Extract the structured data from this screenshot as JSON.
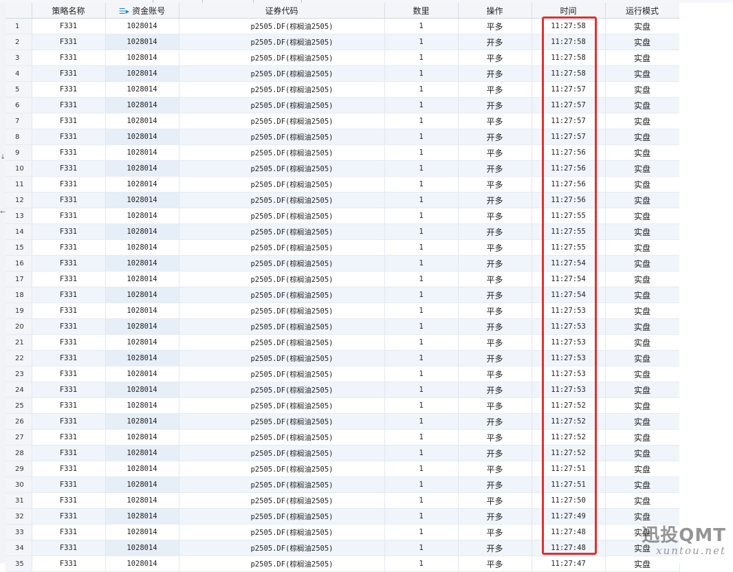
{
  "table": {
    "columns": [
      "",
      "策略名称",
      "资金账号",
      "证券代码",
      "数里",
      "操作",
      "时间",
      "运行模式"
    ],
    "sorted_column_icon": "sort-desc-icon",
    "rows": [
      {
        "n": "1",
        "strategy": "F331",
        "account": "1028014",
        "code": "p2505.DF(棕榈油2505)",
        "qty": "1",
        "op": "平多",
        "time": "11:27:58",
        "mode": "实盘"
      },
      {
        "n": "2",
        "strategy": "F331",
        "account": "1028014",
        "code": "p2505.DF(棕榈油2505)",
        "qty": "1",
        "op": "开多",
        "time": "11:27:58",
        "mode": "实盘"
      },
      {
        "n": "3",
        "strategy": "F331",
        "account": "1028014",
        "code": "p2505.DF(棕榈油2505)",
        "qty": "1",
        "op": "平多",
        "time": "11:27:58",
        "mode": "实盘"
      },
      {
        "n": "4",
        "strategy": "F331",
        "account": "1028014",
        "code": "p2505.DF(棕榈油2505)",
        "qty": "1",
        "op": "开多",
        "time": "11:27:58",
        "mode": "实盘"
      },
      {
        "n": "5",
        "strategy": "F331",
        "account": "1028014",
        "code": "p2505.DF(棕榈油2505)",
        "qty": "1",
        "op": "平多",
        "time": "11:27:57",
        "mode": "实盘"
      },
      {
        "n": "6",
        "strategy": "F331",
        "account": "1028014",
        "code": "p2505.DF(棕榈油2505)",
        "qty": "1",
        "op": "开多",
        "time": "11:27:57",
        "mode": "实盘"
      },
      {
        "n": "7",
        "strategy": "F331",
        "account": "1028014",
        "code": "p2505.DF(棕榈油2505)",
        "qty": "1",
        "op": "平多",
        "time": "11:27:57",
        "mode": "实盘"
      },
      {
        "n": "8",
        "strategy": "F331",
        "account": "1028014",
        "code": "p2505.DF(棕榈油2505)",
        "qty": "1",
        "op": "开多",
        "time": "11:27:57",
        "mode": "实盘"
      },
      {
        "n": "9",
        "strategy": "F331",
        "account": "1028014",
        "code": "p2505.DF(棕榈油2505)",
        "qty": "1",
        "op": "平多",
        "time": "11:27:56",
        "mode": "实盘"
      },
      {
        "n": "10",
        "strategy": "F331",
        "account": "1028014",
        "code": "p2505.DF(棕榈油2505)",
        "qty": "1",
        "op": "开多",
        "time": "11:27:56",
        "mode": "实盘"
      },
      {
        "n": "11",
        "strategy": "F331",
        "account": "1028014",
        "code": "p2505.DF(棕榈油2505)",
        "qty": "1",
        "op": "平多",
        "time": "11:27:56",
        "mode": "实盘"
      },
      {
        "n": "12",
        "strategy": "F331",
        "account": "1028014",
        "code": "p2505.DF(棕榈油2505)",
        "qty": "1",
        "op": "开多",
        "time": "11:27:56",
        "mode": "实盘"
      },
      {
        "n": "13",
        "strategy": "F331",
        "account": "1028014",
        "code": "p2505.DF(棕榈油2505)",
        "qty": "1",
        "op": "平多",
        "time": "11:27:55",
        "mode": "实盘"
      },
      {
        "n": "14",
        "strategy": "F331",
        "account": "1028014",
        "code": "p2505.DF(棕榈油2505)",
        "qty": "1",
        "op": "开多",
        "time": "11:27:55",
        "mode": "实盘"
      },
      {
        "n": "15",
        "strategy": "F331",
        "account": "1028014",
        "code": "p2505.DF(棕榈油2505)",
        "qty": "1",
        "op": "平多",
        "time": "11:27:55",
        "mode": "实盘"
      },
      {
        "n": "16",
        "strategy": "F331",
        "account": "1028014",
        "code": "p2505.DF(棕榈油2505)",
        "qty": "1",
        "op": "开多",
        "time": "11:27:54",
        "mode": "实盘"
      },
      {
        "n": "17",
        "strategy": "F331",
        "account": "1028014",
        "code": "p2505.DF(棕榈油2505)",
        "qty": "1",
        "op": "平多",
        "time": "11:27:54",
        "mode": "实盘"
      },
      {
        "n": "18",
        "strategy": "F331",
        "account": "1028014",
        "code": "p2505.DF(棕榈油2505)",
        "qty": "1",
        "op": "开多",
        "time": "11:27:54",
        "mode": "实盘"
      },
      {
        "n": "19",
        "strategy": "F331",
        "account": "1028014",
        "code": "p2505.DF(棕榈油2505)",
        "qty": "1",
        "op": "平多",
        "time": "11:27:53",
        "mode": "实盘"
      },
      {
        "n": "20",
        "strategy": "F331",
        "account": "1028014",
        "code": "p2505.DF(棕榈油2505)",
        "qty": "1",
        "op": "开多",
        "time": "11:27:53",
        "mode": "实盘"
      },
      {
        "n": "21",
        "strategy": "F331",
        "account": "1028014",
        "code": "p2505.DF(棕榈油2505)",
        "qty": "1",
        "op": "平多",
        "time": "11:27:53",
        "mode": "实盘"
      },
      {
        "n": "22",
        "strategy": "F331",
        "account": "1028014",
        "code": "p2505.DF(棕榈油2505)",
        "qty": "1",
        "op": "开多",
        "time": "11:27:53",
        "mode": "实盘"
      },
      {
        "n": "23",
        "strategy": "F331",
        "account": "1028014",
        "code": "p2505.DF(棕榈油2505)",
        "qty": "1",
        "op": "平多",
        "time": "11:27:53",
        "mode": "实盘"
      },
      {
        "n": "24",
        "strategy": "F331",
        "account": "1028014",
        "code": "p2505.DF(棕榈油2505)",
        "qty": "1",
        "op": "开多",
        "time": "11:27:53",
        "mode": "实盘"
      },
      {
        "n": "25",
        "strategy": "F331",
        "account": "1028014",
        "code": "p2505.DF(棕榈油2505)",
        "qty": "1",
        "op": "平多",
        "time": "11:27:52",
        "mode": "实盘"
      },
      {
        "n": "26",
        "strategy": "F331",
        "account": "1028014",
        "code": "p2505.DF(棕榈油2505)",
        "qty": "1",
        "op": "开多",
        "time": "11:27:52",
        "mode": "实盘"
      },
      {
        "n": "27",
        "strategy": "F331",
        "account": "1028014",
        "code": "p2505.DF(棕榈油2505)",
        "qty": "1",
        "op": "平多",
        "time": "11:27:52",
        "mode": "实盘"
      },
      {
        "n": "28",
        "strategy": "F331",
        "account": "1028014",
        "code": "p2505.DF(棕榈油2505)",
        "qty": "1",
        "op": "开多",
        "time": "11:27:52",
        "mode": "实盘"
      },
      {
        "n": "29",
        "strategy": "F331",
        "account": "1028014",
        "code": "p2505.DF(棕榈油2505)",
        "qty": "1",
        "op": "平多",
        "time": "11:27:51",
        "mode": "实盘"
      },
      {
        "n": "30",
        "strategy": "F331",
        "account": "1028014",
        "code": "p2505.DF(棕榈油2505)",
        "qty": "1",
        "op": "开多",
        "time": "11:27:51",
        "mode": "实盘"
      },
      {
        "n": "31",
        "strategy": "F331",
        "account": "1028014",
        "code": "p2505.DF(棕榈油2505)",
        "qty": "1",
        "op": "平多",
        "time": "11:27:50",
        "mode": "实盘"
      },
      {
        "n": "32",
        "strategy": "F331",
        "account": "1028014",
        "code": "p2505.DF(棕榈油2505)",
        "qty": "1",
        "op": "开多",
        "time": "11:27:49",
        "mode": "实盘"
      },
      {
        "n": "33",
        "strategy": "F331",
        "account": "1028014",
        "code": "p2505.DF(棕榈油2505)",
        "qty": "1",
        "op": "平多",
        "time": "11:27:48",
        "mode": "实盘"
      },
      {
        "n": "34",
        "strategy": "F331",
        "account": "1028014",
        "code": "p2505.DF(棕榈油2505)",
        "qty": "1",
        "op": "开多",
        "time": "11:27:48",
        "mode": "实盘"
      },
      {
        "n": "35",
        "strategy": "F331",
        "account": "1028014",
        "code": "p2505.DF(棕榈油2505)",
        "qty": "1",
        "op": "平多",
        "time": "11:27:47",
        "mode": "实盘"
      }
    ]
  },
  "highlight": {
    "color": "#e02f2f"
  },
  "watermark": {
    "brand": "迅投QMT",
    "url": "xuntou.net"
  },
  "left_gutter": {
    "marks": [
      "↓",
      "←"
    ]
  }
}
